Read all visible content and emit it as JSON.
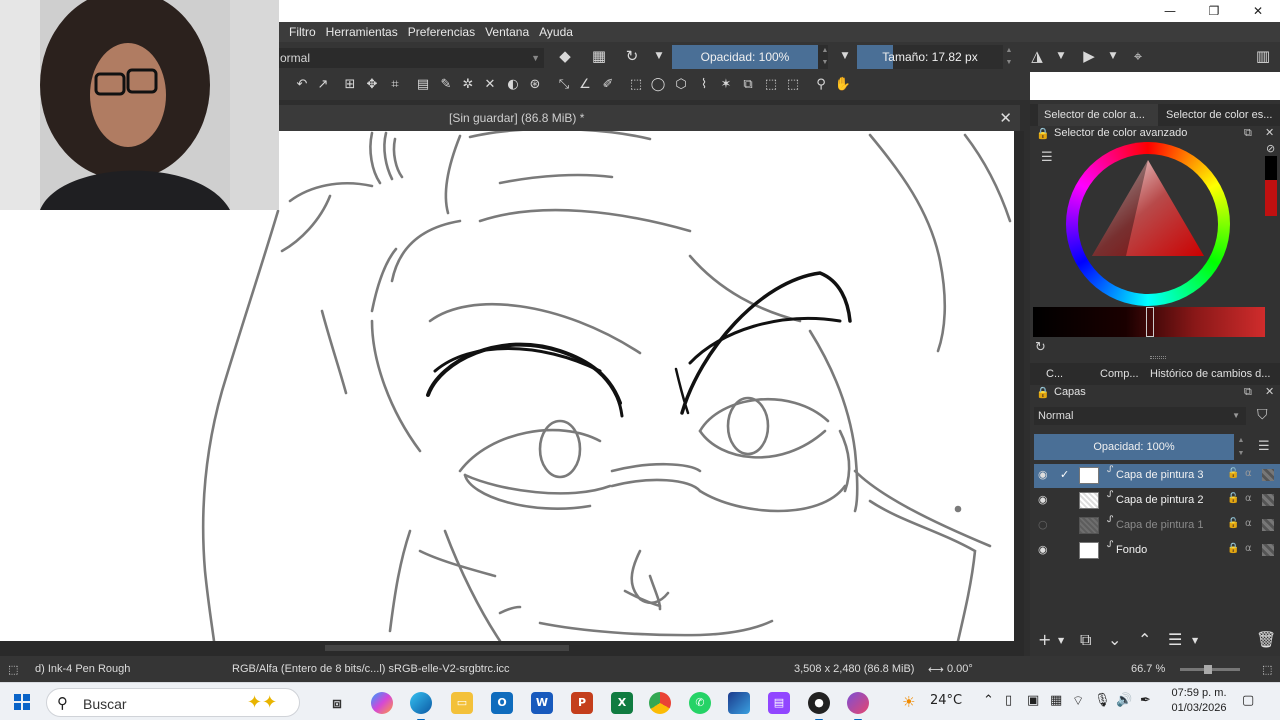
{
  "window": {
    "minimize": "—",
    "restore": "❐",
    "close": "✕"
  },
  "menu": [
    "Filtro",
    "Herramientas",
    "Preferencias",
    "Ventana",
    "Ayuda"
  ],
  "tool_options": {
    "blend_mode": "ormal",
    "opacity_label": "Opacidad: 100%",
    "size_label": "Tamaño: 17.82 px"
  },
  "document": {
    "tab_title": "[Sin guardar]  (86.8 MiB) *"
  },
  "dockers": {
    "color_tabs": [
      "Selector de color a...",
      "Selector de color es..."
    ],
    "color_panel_title": "Selector de color avanzado",
    "layer_tabs": [
      "C...",
      "Comp...",
      "Histórico de cambios d..."
    ],
    "layers_title": "Capas",
    "layer_blend": "Normal",
    "layer_opacity": "Opacidad:  100%",
    "layers": [
      {
        "name": "Capa de pintura 3",
        "visible": true,
        "active": true
      },
      {
        "name": "Capa de pintura 2",
        "visible": true,
        "active": false
      },
      {
        "name": "Capa de pintura 1",
        "visible": false,
        "active": false
      },
      {
        "name": "Fondo",
        "visible": true,
        "active": false,
        "locked": true
      }
    ]
  },
  "status": {
    "brush": "d) Ink-4 Pen Rough",
    "color_space": "RGB/Alfa (Entero de 8 bits/c...l)  sRGB-elle-V2-srgbtrc.icc",
    "dimensions": "3,508 x 2,480 (86.8 MiB)",
    "rotation": "0.00°",
    "zoom": "66.7 %"
  },
  "taskbar": {
    "search_placeholder": "Buscar",
    "weather": "24°C",
    "time": "07:59 p. m.",
    "date": "01/03/2026"
  },
  "colors": {
    "accent": "#4a6f96",
    "panel": "#323232",
    "menubar": "#3c3c3c"
  }
}
